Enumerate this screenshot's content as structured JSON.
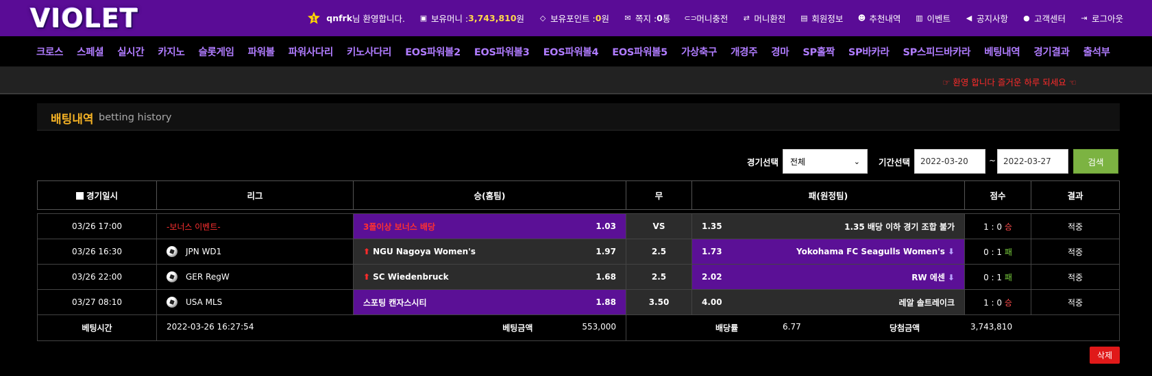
{
  "header": {
    "logo": "VIOLET",
    "level": "1",
    "username": "qnfrk",
    "welcome_suffix": "님 환영합니다.",
    "money_label": "보유머니 : ",
    "money_value": "3,743,810",
    "money_unit": "원",
    "point_label": "보유포인트 : ",
    "point_value": "0",
    "point_unit": "원",
    "message_label": "쪽지 : ",
    "message_value": "0",
    "message_unit": " 통",
    "links": [
      "머니충전",
      "머니환전",
      "회원정보",
      "추천내역",
      "이벤트",
      "공지사항",
      "고객센터",
      "로그아웃"
    ]
  },
  "nav": [
    "크로스",
    "스페셜",
    "실시간",
    "카지노",
    "슬롯게임",
    "파워볼",
    "파워사다리",
    "키노사다리",
    "EOS파워볼2",
    "EOS파워볼3",
    "EOS파워볼4",
    "EOS파워볼5",
    "가상축구",
    "개경주",
    "경마",
    "SP홀짝",
    "SP바카라",
    "SP스피드바카라",
    "베팅내역",
    "경기결과",
    "출석부"
  ],
  "notice": "☞ 환영 합니다 즐거운 하루 되세요 ☜",
  "page": {
    "title": "배팅내역",
    "subtitle": "betting history"
  },
  "filters": {
    "game_label": "경기선택",
    "game_selected": "전체",
    "period_label": "기간선택",
    "date_from": "2022-03-20",
    "date_to": "2022-03-27",
    "tilde": "~",
    "search": "검색"
  },
  "columns": [
    "경기일시",
    "리그",
    "승(홈팀)",
    "무",
    "패(원정팀)",
    "점수",
    "결과"
  ],
  "rows": [
    {
      "date": "03/26 17:00",
      "league": "-보너스 이벤트-",
      "home": "3폴이상 보너스 배당",
      "home_odds": "1.03",
      "draw": "VS",
      "away_odds": "1.35",
      "away": "1.35 배당 이하 경기 조합 불가",
      "score": "1 : 0",
      "outcome": "승",
      "result": "적중"
    },
    {
      "date": "03/26 16:30",
      "league": "JPN WD1",
      "home": "NGU Nagoya Women's",
      "home_odds": "1.97",
      "draw": "2.5",
      "away_odds": "1.73",
      "away": "Yokohama FC Seagulls Women's",
      "score": "0 : 1",
      "outcome": "패",
      "result": "적중"
    },
    {
      "date": "03/26 22:00",
      "league": "GER RegW",
      "home": "SC Wiedenbruck",
      "home_odds": "1.68",
      "draw": "2.5",
      "away_odds": "2.02",
      "away": "RW 에센",
      "score": "0 : 1",
      "outcome": "패",
      "result": "적중"
    },
    {
      "date": "03/27 08:10",
      "league": "USA MLS",
      "home": "스포팅 캔자스시티",
      "home_odds": "1.88",
      "draw": "3.50",
      "away_odds": "4.00",
      "away": "레알 솔트레이크",
      "score": "1 : 0",
      "outcome": "승",
      "result": "적중"
    }
  ],
  "summary": {
    "bet_time_label": "베팅시간",
    "bet_time": "2022-03-26 16:27:54",
    "bet_amount_label": "베팅금액",
    "bet_amount": "553,000",
    "odds_label": "배당률",
    "odds": "6.77",
    "win_amount_label": "당첨금액",
    "win_amount": "3,743,810"
  },
  "delete_label": "삭제"
}
